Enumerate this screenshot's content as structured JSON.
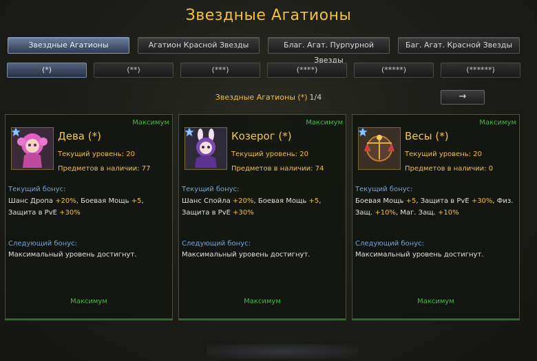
{
  "page": {
    "title": "Звездные Агатионы"
  },
  "tabs": [
    {
      "label": "Звездные Агатионы",
      "active": true
    },
    {
      "label": "Агатион Красной Звезды",
      "active": false
    },
    {
      "label": "Благ. Агат. Пурпурной Звезды",
      "active": false
    },
    {
      "label": "Баг. Агат. Красной Звезды",
      "active": false
    }
  ],
  "star_filters": [
    {
      "label": "(*)",
      "active": true
    },
    {
      "label": "(**)",
      "active": false
    },
    {
      "label": "(***)",
      "active": false
    },
    {
      "label": "(****)",
      "active": false
    },
    {
      "label": "(*****)",
      "active": false
    },
    {
      "label": "(******)",
      "active": false
    }
  ],
  "pager": {
    "label": "Звездные Агатионы (*)",
    "page": "1/4",
    "next": "→"
  },
  "cards": [
    {
      "status_top": "Максимум",
      "name": "Дева (*)",
      "level_label": "Текущий уровень:",
      "level": "20",
      "count_label": "Предметов в наличии:",
      "count": "77",
      "current_bonus_label": "Текущий бонус:",
      "current_bonus_parts": [
        "Шанс Дропа ",
        "+20%",
        ", Боевая Мощь ",
        "+5",
        ",",
        " Защита в PvE ",
        "+30%"
      ],
      "next_bonus_label": "Следующий бонус:",
      "next_bonus": "Максимальный уровень достигнут.",
      "status_bottom": "Максимум",
      "icon": "star-icon",
      "accent": "#e060c0"
    },
    {
      "status_top": "Максимум",
      "name": "Козерог (*)",
      "level_label": "Текущий уровень:",
      "level": "20",
      "count_label": "Предметов в наличии:",
      "count": "74",
      "current_bonus_label": "Текущий бонус:",
      "current_bonus_parts": [
        "Шанс Спойла ",
        "+20%",
        ", Боевая Мощь ",
        "+5",
        ",",
        " Защита в PvE ",
        "+30%"
      ],
      "next_bonus_label": "Следующий бонус:",
      "next_bonus": "Максимальный уровень достигнут.",
      "status_bottom": "Максимум",
      "icon": "star-icon",
      "accent": "#7a4ab0"
    },
    {
      "status_top": "Максимум",
      "name": "Весы (*)",
      "level_label": "Текущий уровень:",
      "level": "20",
      "count_label": "Предметов в наличии:",
      "count": "0",
      "current_bonus_label": "Текущий бонус:",
      "current_bonus_parts": [
        "Боевая Мощь ",
        "+5",
        ", Защита в PvE ",
        "+30%",
        ", Физ. Защ. ",
        "+10%",
        ", Маг. Защ. ",
        "+10%"
      ],
      "next_bonus_label": "Следующий бонус:",
      "next_bonus": "Максимальный уровень достигнут.",
      "status_bottom": "Максимум",
      "icon": "star-icon",
      "accent": "#c08030"
    }
  ]
}
